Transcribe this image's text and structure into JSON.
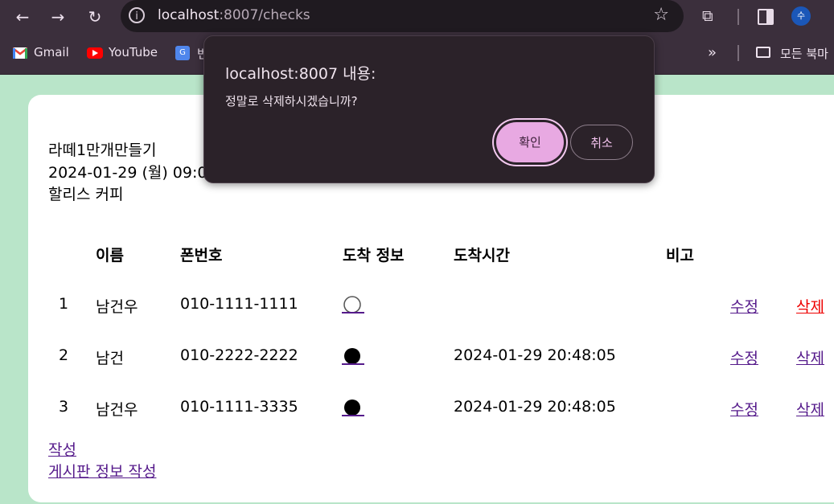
{
  "browser": {
    "url_host": "localhost",
    "url_rest": ":8007/checks",
    "avatar_letter": "수",
    "bookmarks": [
      {
        "label": "Gmail"
      },
      {
        "label": "YouTube"
      },
      {
        "label": "번"
      }
    ],
    "all_bookmarks_label": "모든 북마"
  },
  "page": {
    "event_title": "라떼1만개만들기",
    "event_datetime": "2024-01-29 (월) 09:00",
    "event_place": "할리스 커피",
    "table": {
      "headers": {
        "name": "이름",
        "phone": "폰번호",
        "arrival": "도착 정보",
        "arrival_time": "도착시간",
        "note": "비고"
      },
      "rows": [
        {
          "no": "1",
          "name": "남건우",
          "phone": "010-1111-1111",
          "arrived": false,
          "time": "",
          "edit": "수정",
          "delete": "삭제"
        },
        {
          "no": "2",
          "name": "남건",
          "phone": "010-2222-2222",
          "arrived": true,
          "time": "2024-01-29 20:48:05",
          "edit": "수정",
          "delete": "삭제"
        },
        {
          "no": "3",
          "name": "남건우",
          "phone": "010-1111-3335",
          "arrived": true,
          "time": "2024-01-29 20:48:05",
          "edit": "수정",
          "delete": "삭제"
        }
      ]
    },
    "links": {
      "create": "작성",
      "create_board_info": "게시판 정보 작성"
    }
  },
  "dialog": {
    "title": "localhost:8007 내용:",
    "message": "정말로 삭제하시겠습니까?",
    "ok": "확인",
    "cancel": "취소"
  },
  "colors": {
    "page_bg": "#b9e5c9",
    "link": "#551a8b",
    "active_link": "#ee0000",
    "dialog_ok": "#e8a9e2"
  }
}
